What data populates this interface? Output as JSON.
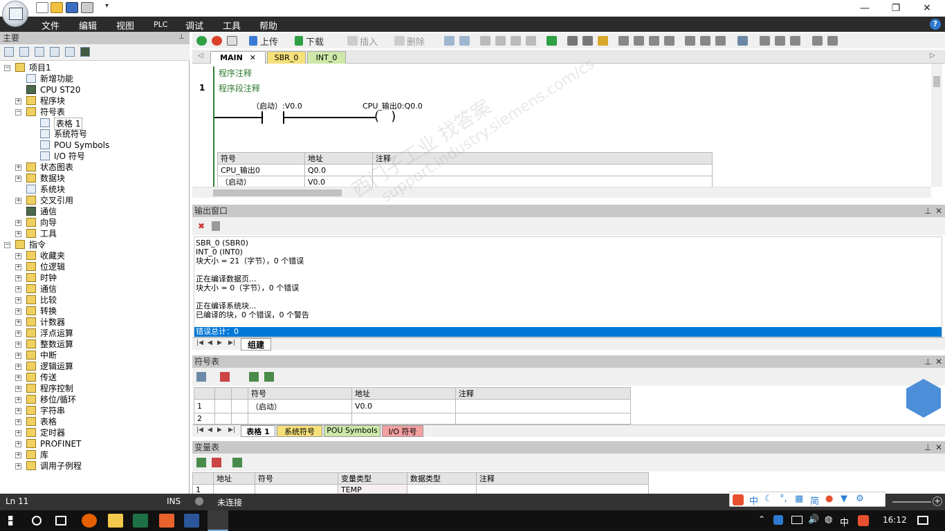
{
  "menu": {
    "items": [
      "文件",
      "编辑",
      "视图",
      "PLC",
      "调试",
      "工具",
      "帮助"
    ],
    "help": "?"
  },
  "window": {
    "minimize": "—",
    "restore": "❐",
    "close": "✕"
  },
  "left": {
    "title": "主要",
    "tree": [
      {
        "label": "项目1",
        "level": 0
      },
      {
        "label": "新增功能",
        "level": 1
      },
      {
        "label": "CPU ST20",
        "level": 1
      },
      {
        "label": "程序块",
        "level": 1
      },
      {
        "label": "符号表",
        "level": 1
      },
      {
        "label": "表格 1",
        "level": 2
      },
      {
        "label": "系统符号",
        "level": 2
      },
      {
        "label": "POU Symbols",
        "level": 2
      },
      {
        "label": "I/O 符号",
        "level": 2
      },
      {
        "label": "状态图表",
        "level": 1
      },
      {
        "label": "数据块",
        "level": 1
      },
      {
        "label": "系统块",
        "level": 1
      },
      {
        "label": "交叉引用",
        "level": 1
      },
      {
        "label": "通信",
        "level": 1
      },
      {
        "label": "向导",
        "level": 1
      },
      {
        "label": "工具",
        "level": 1
      },
      {
        "label": "指令",
        "level": 0
      },
      {
        "label": "收藏夹",
        "level": 1
      },
      {
        "label": "位逻辑",
        "level": 1
      },
      {
        "label": "时钟",
        "level": 1
      },
      {
        "label": "通信",
        "level": 1
      },
      {
        "label": "比较",
        "level": 1
      },
      {
        "label": "转换",
        "level": 1
      },
      {
        "label": "计数器",
        "level": 1
      },
      {
        "label": "浮点运算",
        "level": 1
      },
      {
        "label": "整数运算",
        "level": 1
      },
      {
        "label": "中断",
        "level": 1
      },
      {
        "label": "逻辑运算",
        "level": 1
      },
      {
        "label": "传送",
        "level": 1
      },
      {
        "label": "程序控制",
        "level": 1
      },
      {
        "label": "移位/循环",
        "level": 1
      },
      {
        "label": "字符串",
        "level": 1
      },
      {
        "label": "表格",
        "level": 1
      },
      {
        "label": "定时器",
        "level": 1
      },
      {
        "label": "PROFINET",
        "level": 1
      },
      {
        "label": "库",
        "level": 1
      },
      {
        "label": "调用子例程",
        "level": 1
      }
    ]
  },
  "toolbar": {
    "upload": "上传",
    "download": "下载",
    "insert": "插入",
    "delete": "删除"
  },
  "tabs": [
    "MAIN",
    "SBR_0",
    "INT_0"
  ],
  "editor": {
    "program_comment": "程序注释",
    "network_number": "1",
    "network_comment": "程序段注释",
    "contact_label": "（启动）:V0.0",
    "coil_label": "CPU_输出0:Q0.0",
    "symtable": {
      "headers": [
        "符号",
        "地址",
        "注释"
      ],
      "rows": [
        [
          "CPU_输出0",
          "Q0.0",
          ""
        ],
        [
          "（启动）",
          "V0.0",
          ""
        ]
      ]
    }
  },
  "output": {
    "title": "输出窗口",
    "lines": [
      "SBR_0 (SBR0)",
      "INT_0 (INT0)",
      "块大小 = 21（字节），0 个错误",
      "",
      "正在编译数据页...",
      "块大小 = 0（字节），0 个错误",
      "",
      "正在编译系统块...",
      "已编译的块，0 个错误，0 个警告"
    ],
    "total": "错误总计：0",
    "tab": "组建"
  },
  "symbols": {
    "title": "符号表",
    "headers": [
      "符号",
      "地址",
      "注释"
    ],
    "rows": [
      [
        "1",
        "（启动）",
        "V0.0",
        ""
      ],
      [
        "2",
        "",
        "",
        ""
      ]
    ],
    "tabs": [
      "表格 1",
      "系统符号",
      "POU Symbols",
      "I/O 符号"
    ]
  },
  "vars": {
    "title": "变量表",
    "headers": [
      "地址",
      "符号",
      "变量类型",
      "数据类型",
      "注释"
    ],
    "rows": [
      [
        "1",
        "",
        "TEMP",
        "",
        ""
      ]
    ]
  },
  "status": {
    "ln": "Ln 11",
    "ins": "INS",
    "conn": "未连接"
  },
  "ime": {
    "items": [
      "中",
      "简"
    ]
  },
  "taskbar": {
    "time": "16:12",
    "lang": "中"
  },
  "watermark": {
    "line1": "西门子工业 找答案",
    "line2": "support.industry.siemens.com/cs"
  },
  "colors": {
    "selection": "#0078d7",
    "ladder_green": "#2f7a2f",
    "tab_yellow": "#f5e07a",
    "tab_green": "#cde8a8",
    "tab_red": "#f2a0a0"
  }
}
